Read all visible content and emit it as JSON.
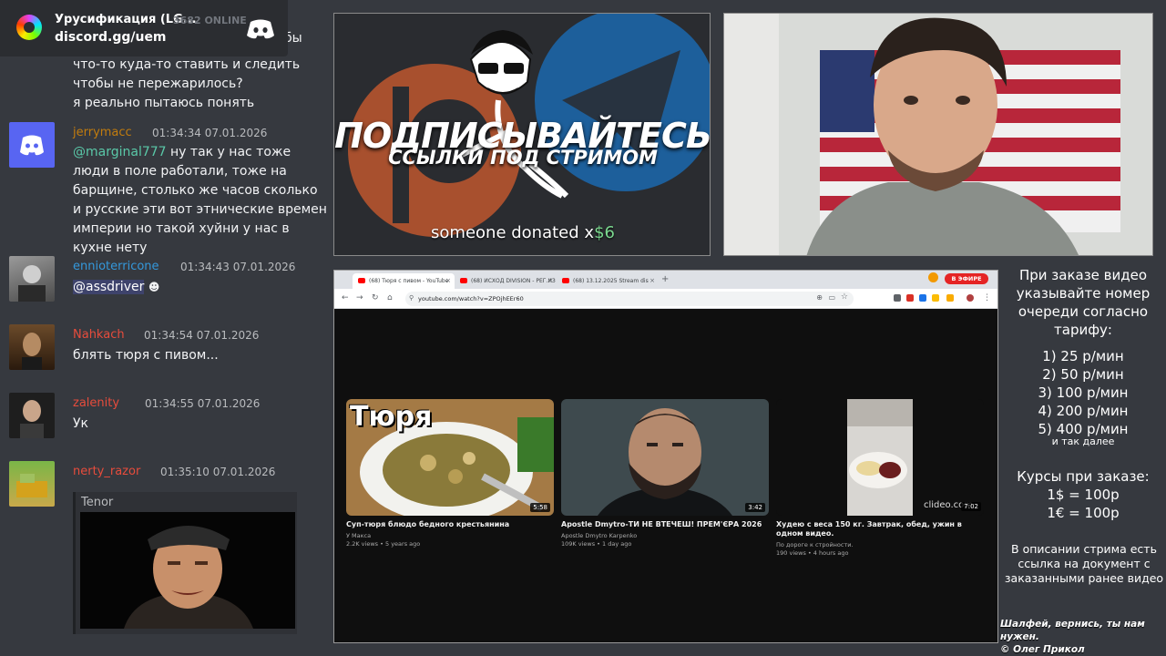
{
  "discord": {
    "server_name": "Урусификация (LG...",
    "online": "3682 ONLINE",
    "invite": "discord.gg/uem"
  },
  "chat": {
    "first_message_lines": [
      "что-то куда-то ставить и следить",
      "чтобы не пережарилось?",
      "я реально пытаюсь понять"
    ],
    "first_message_partial": "бы",
    "messages": [
      {
        "username": "jerrymacc",
        "username_color": "#c27c0e",
        "time": "01:34:34 07.01.2026",
        "mention": "@marginal777",
        "text": " ну так у нас тоже люди в поле работали, тоже на барщине, столько же часов сколько и русские эти вот этнические времен империи но такой хуйни у нас в кухне нету"
      },
      {
        "username": "ennioterricone",
        "username_color": "#3498db",
        "time": "01:34:43 07.01.2026",
        "mention": "@assdriver",
        "text": ""
      },
      {
        "username": "Nahkach",
        "username_color": "#e74c3c",
        "time": "01:34:54 07.01.2026",
        "text": "блять тюря с пивом..."
      },
      {
        "username": "zalenity",
        "username_color": "#e74c3c",
        "time": "01:34:55 07.01.2026",
        "text": "Ук"
      },
      {
        "username": "nerty_razor",
        "username_color": "#e74c3c",
        "time": "01:35:10 07.01.2026",
        "gif_provider": "Tenor"
      }
    ]
  },
  "promo": {
    "title": "ПОДПИСЫВАЙТЕСЬ",
    "subtitle": "ССЫЛКИ ПОД СТРИМОМ",
    "donation_prefix": "someone donated x",
    "donation_amount": "$6"
  },
  "browser": {
    "tabs": [
      "(68) Тюря с пивом - YouTube",
      "(68) ИСХОД DIVISION - РЕГ.ИЗ",
      "(68) 13.12.2025 Stream dis"
    ],
    "live_badge": "В ЭФИРЕ",
    "url": "youtube.com/watch?v=ZPOjhEEr60",
    "videos": [
      {
        "title": "Суп-тюря блюдо бедного крестьянина",
        "channel": "У Макса",
        "meta": "2.2K views • 5 years ago",
        "duration": "5:58",
        "thumb_text": "Тюря"
      },
      {
        "title": "Apostle Dmytro-ТИ НЕ ВТЕЧЕШ! ПРЕМ'ЄРА 2026",
        "channel": "Apostle Dmytro Karpenko",
        "meta": "109K views • 1 day ago",
        "duration": "3:42"
      },
      {
        "title": "Худею с веса 150 кг. Завтрак, обед, ужин в одном видео.",
        "channel": "По дороге к стройности.",
        "meta": "190 views • 4 hours ago",
        "duration": "7:02",
        "watermark": "clideo.com"
      }
    ]
  },
  "info": {
    "heading": "При заказе видео указывайте номер очереди согласно тарифу:",
    "tariffs": [
      "1) 25 р/мин",
      "2) 50 р/мин",
      "3) 100 р/мин",
      "4) 200 р/мин",
      "5) 400 р/мин"
    ],
    "tariff_more": "и так далее",
    "rates_heading": "Курсы при заказе:",
    "rates": [
      "1$ = 100р",
      "1€ = 100р"
    ],
    "description_note": "В описании стрима есть ссылка на документ с заказанными ранее видео",
    "quote": "Шалфей, вернись, ты нам нужен.",
    "quote_author": "© Олег Прикол"
  }
}
